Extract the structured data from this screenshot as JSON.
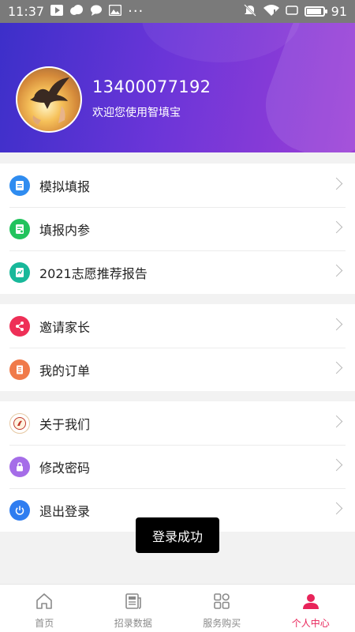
{
  "status_bar": {
    "time": "11:37",
    "more_dots": "···",
    "battery": "91",
    "battery_level_percent": 91
  },
  "profile": {
    "phone": "13400077192",
    "welcome": "欢迎您使用智填宝"
  },
  "menu": {
    "group1": [
      {
        "label": "模拟填报",
        "icon": "document-icon",
        "color": "#2f8cf0"
      },
      {
        "label": "填报内参",
        "icon": "report-icon",
        "color": "#22c35d"
      },
      {
        "label": "2021志愿推荐报告",
        "icon": "chart-doc-icon",
        "color": "#18b89a"
      }
    ],
    "group2": [
      {
        "label": "邀请家长",
        "icon": "share-icon",
        "color": "#ee2f57"
      },
      {
        "label": "我的订单",
        "icon": "order-icon",
        "color": "#f07a4a"
      }
    ],
    "group3": [
      {
        "label": "关于我们",
        "icon": "logo-icon",
        "color": "#c0392b"
      },
      {
        "label": "修改密码",
        "icon": "lock-icon",
        "color": "#a56de8"
      },
      {
        "label": "退出登录",
        "icon": "power-icon",
        "color": "#2f7df0"
      }
    ]
  },
  "toast": "登录成功",
  "tabbar": {
    "tabs": [
      {
        "label": "首页",
        "icon": "home-icon"
      },
      {
        "label": "招录数据",
        "icon": "newspaper-icon"
      },
      {
        "label": "服务购买",
        "icon": "grid-icon"
      },
      {
        "label": "个人中心",
        "icon": "person-icon"
      }
    ],
    "active_color": "#e8245a",
    "inactive_color": "#8a8a8a"
  }
}
